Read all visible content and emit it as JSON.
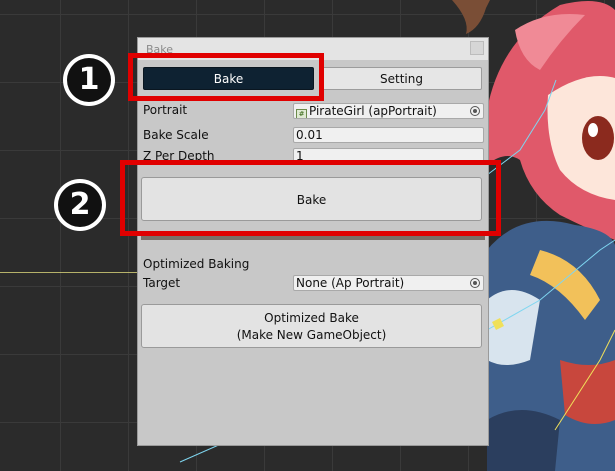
{
  "window": {
    "title": "Bake"
  },
  "tabs": [
    {
      "label": "Bake",
      "active": true
    },
    {
      "label": "Setting",
      "active": false
    }
  ],
  "fields": {
    "portrait_label": "Portrait",
    "portrait_value": "PirateGirl (apPortrait)",
    "portrait_icon": "gameobject-icon",
    "bake_scale_label": "Bake Scale",
    "bake_scale_value": "0.01",
    "z_per_depth_label": "Z Per Depth",
    "z_per_depth_value": "1"
  },
  "bake_button_label": "Bake",
  "optimized": {
    "section_label": "Optimized Baking",
    "target_label": "Target",
    "target_value": "None (Ap Portrait)",
    "button_line1": "Optimized Bake",
    "button_line2": "(Make New GameObject)"
  },
  "annotations": [
    {
      "number": "1",
      "highlights": "bake-tab"
    },
    {
      "number": "2",
      "highlights": "bake-button"
    }
  ],
  "colors": {
    "callout": "#e00000",
    "active_tab": "#0e2232",
    "panel_bg": "#c8c8c8"
  }
}
